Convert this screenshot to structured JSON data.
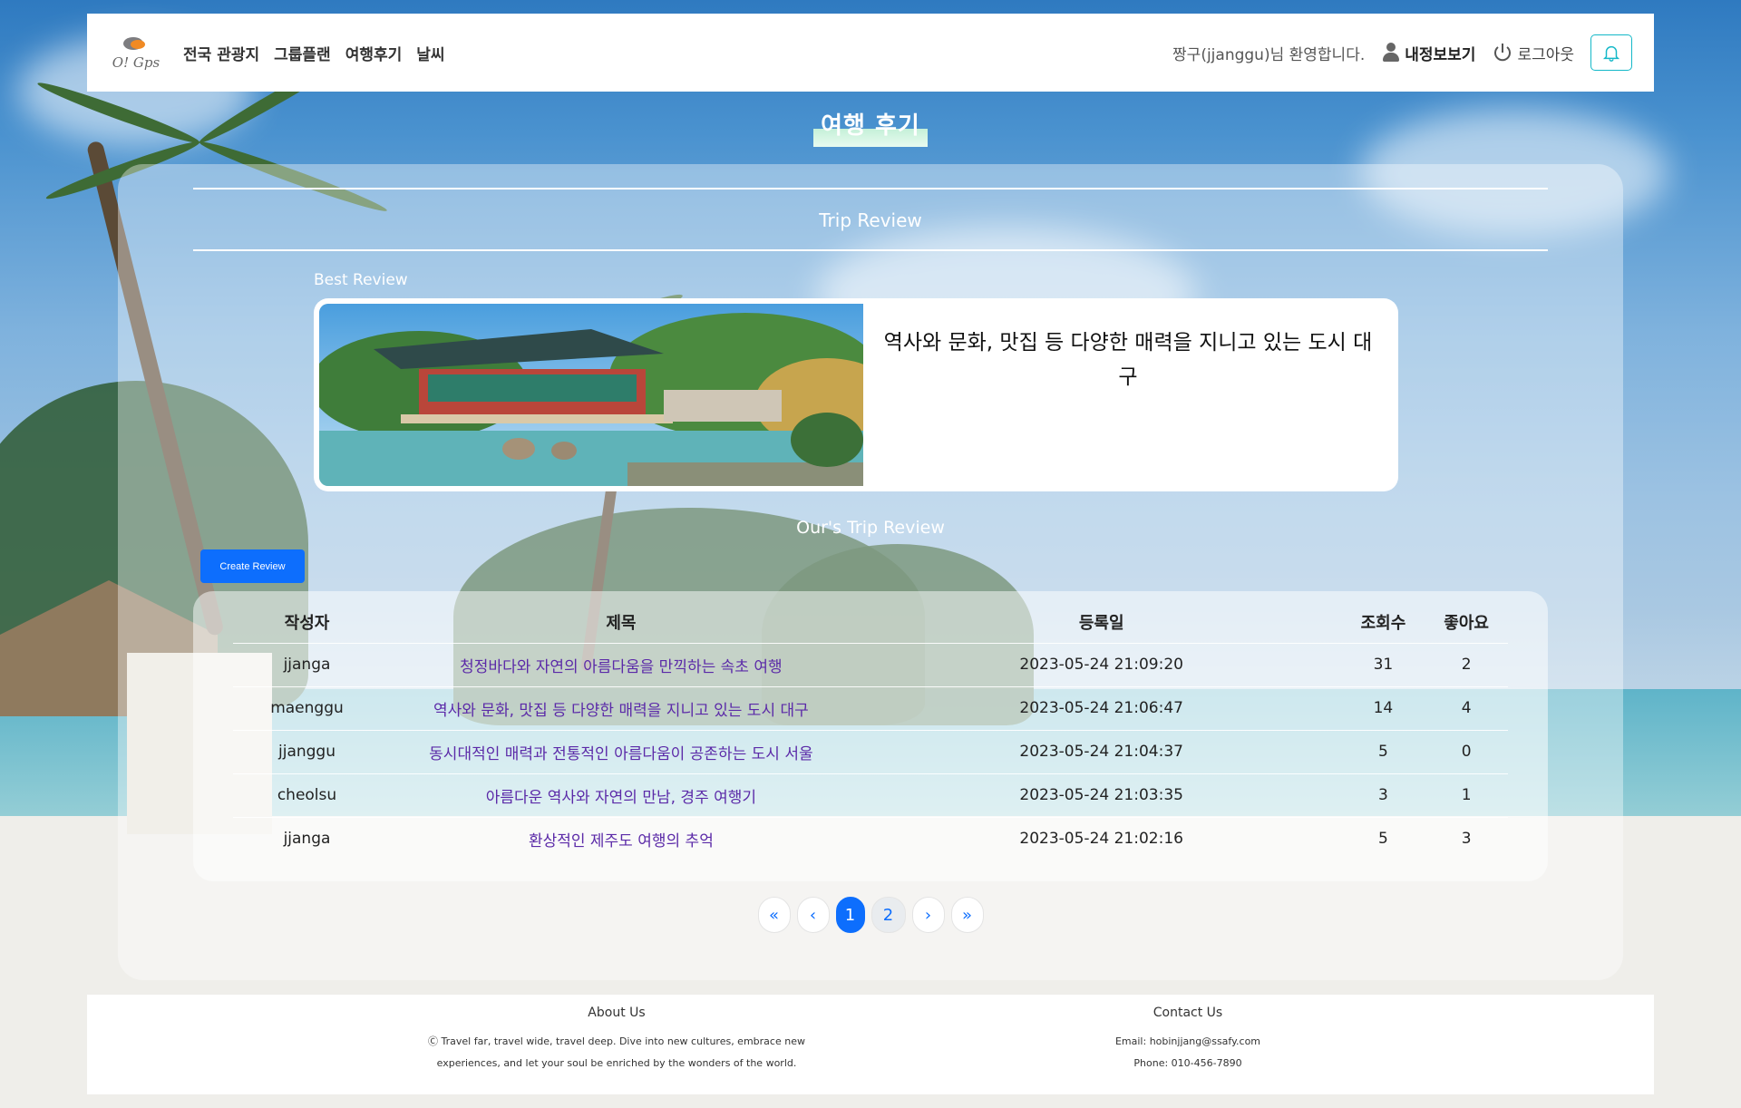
{
  "header": {
    "logo_text": "O! Gps",
    "nav": [
      "전국 관광지",
      "그룹플랜",
      "여행후기",
      "날씨"
    ],
    "welcome": "짱구(jjanggu)님 환영합니다.",
    "mypage_label": "내정보보기",
    "logout_label": "로그아웃"
  },
  "page": {
    "title": "여행 후기"
  },
  "panel": {
    "section_title": "Trip Review",
    "best_label": "Best Review",
    "best_title": "역사와 문화, 맛집 등 다양한 매력을 지니고 있는 도시 대구",
    "ours_title": "Our's Trip Review",
    "create_button": "Create Review"
  },
  "table": {
    "headers": [
      "작성자",
      "제목",
      "등록일",
      "조회수",
      "좋아요"
    ],
    "rows": [
      {
        "author": "jjanga",
        "title": "청정바다와 자연의 아름다움을 만끽하는 속초 여행",
        "date": "2023-05-24 21:09:20",
        "views": "31",
        "likes": "2"
      },
      {
        "author": "maenggu",
        "title": "역사와 문화, 맛집 등 다양한 매력을 지니고 있는 도시 대구",
        "date": "2023-05-24 21:06:47",
        "views": "14",
        "likes": "4"
      },
      {
        "author": "jjanggu",
        "title": "동시대적인 매력과 전통적인 아름다움이 공존하는 도시 서울",
        "date": "2023-05-24 21:04:37",
        "views": "5",
        "likes": "0"
      },
      {
        "author": "cheolsu",
        "title": "아름다운 역사와 자연의 만남, 경주 여행기",
        "date": "2023-05-24 21:03:35",
        "views": "3",
        "likes": "1"
      },
      {
        "author": "jjanga",
        "title": "환상적인 제주도 여행의 추억",
        "date": "2023-05-24 21:02:16",
        "views": "5",
        "likes": "3"
      }
    ]
  },
  "pagination": {
    "first": "«",
    "prev": "‹",
    "pages": [
      "1",
      "2"
    ],
    "active": "1",
    "next": "›",
    "last": "»"
  },
  "footer": {
    "about_title": "About Us",
    "about_text_1": "Ⓒ Travel far, travel wide, travel deep. Dive into new cultures, embrace new",
    "about_text_2": "experiences, and let your soul be enriched by the wonders of the world.",
    "contact_title": "Contact Us",
    "email": "Email: hobinjjang@ssafy.com",
    "phone": "Phone: 010-456-7890"
  },
  "colors": {
    "primary": "#0d6efd",
    "title_link": "#5b2aa8",
    "bell_border": "#14b8c8"
  }
}
